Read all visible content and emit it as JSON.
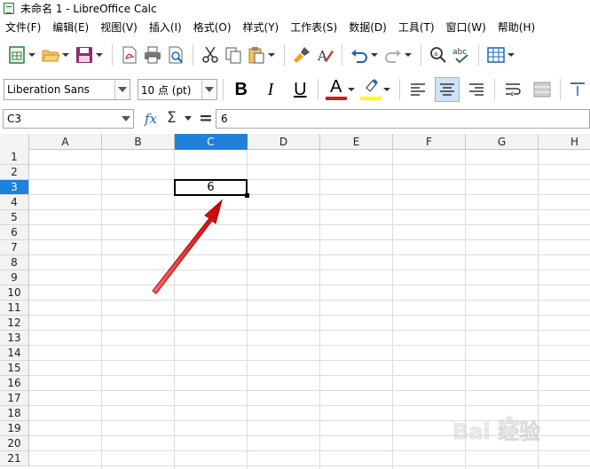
{
  "window": {
    "title": "未命名 1 - LibreOffice Calc"
  },
  "menu": [
    "文件(F)",
    "编辑(E)",
    "视图(V)",
    "插入(I)",
    "格式(O)",
    "样式(Y)",
    "工作表(S)",
    "数据(D)",
    "工具(T)",
    "窗口(W)",
    "帮助(H)"
  ],
  "toolbar2": {
    "font_name": "Liberation Sans",
    "font_size": "10 点 (pt)",
    "bold": "B",
    "italic": "I",
    "underline": "U",
    "font_color_glyph": "A"
  },
  "formula_bar": {
    "name_box": "C3",
    "fx": "fx",
    "sum": "Σ",
    "equals": "=",
    "content": "6"
  },
  "sheet": {
    "columns": [
      "A",
      "B",
      "C",
      "D",
      "E",
      "F",
      "G",
      "H"
    ],
    "rows": [
      "1",
      "2",
      "3",
      "4",
      "5",
      "6",
      "7",
      "8",
      "9",
      "10",
      "11",
      "12",
      "13",
      "14",
      "15",
      "16",
      "17",
      "18",
      "19",
      "20",
      "21"
    ],
    "selected_column": "C",
    "selected_row": "3",
    "active_cell": {
      "ref": "C3",
      "value": "6"
    }
  },
  "colors": {
    "selection_header": "#1f82d8",
    "annotation_arrow": "#e01010",
    "accent_green": "#2e7d32"
  },
  "watermark": {
    "text": "Bai 经验"
  }
}
